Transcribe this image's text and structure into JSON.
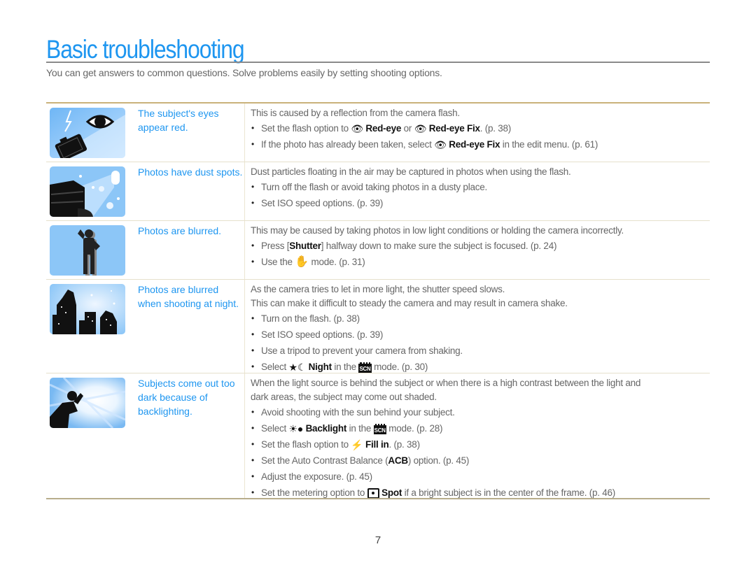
{
  "page": {
    "title": "Basic troubleshooting",
    "intro": "You can get answers to common questions. Solve problems easily by setting shooting options.",
    "page_number": "7",
    "accent_color": "#1e96f0",
    "rule_color": "#c9b27a"
  },
  "rows": [
    {
      "problem": "The subject's eyes appear red.",
      "image": "red-eye-illustration",
      "lead": [
        "This is caused by a reflection from the camera flash."
      ],
      "bullets": [
        {
          "pre": "Set the flash option to ",
          "icon1": "red-eye-icon",
          "bold1": "Red-eye",
          "mid": " or ",
          "icon2": "red-eye-fix-icon",
          "bold2": "Red-eye Fix",
          "post": ". (p. 38)"
        },
        {
          "pre": "If the photo has already been taken, select ",
          "icon1": "red-eye-fix-icon",
          "bold1": "Red-eye Fix",
          "post": " in the edit menu. (p. 61)"
        }
      ]
    },
    {
      "problem": "Photos have dust spots.",
      "image": "dust-spots-illustration",
      "lead": [
        "Dust particles floating in the air may be captured in photos when using the flash."
      ],
      "bullets": [
        {
          "text": "Turn off the flash or avoid taking photos in a dusty place."
        },
        {
          "text": "Set ISO speed options. (p. 39)"
        }
      ]
    },
    {
      "problem": "Photos are blurred.",
      "image": "blurred-person-illustration",
      "lead": [
        "This may be caused by taking photos in low light conditions or holding the camera incorrectly."
      ],
      "bullets": [
        {
          "pre": "Press [",
          "bold1": "Shutter",
          "post": "] halfway down to make sure the subject is focused. (p. 24)"
        },
        {
          "pre": "Use the ",
          "icon1": "dual-is-icon",
          "post": " mode. (p. 31)"
        }
      ]
    },
    {
      "problem": "Photos are blurred when shooting at night.",
      "image": "night-city-illustration",
      "lead": [
        "As the camera tries to let in more light, the shutter speed slows.",
        "This can make it difficult to steady the camera and may result in camera shake."
      ],
      "bullets": [
        {
          "text": "Turn on the flash. (p. 38)"
        },
        {
          "text": "Set ISO speed options. (p. 39)"
        },
        {
          "text": "Use a tripod to prevent your camera from shaking."
        },
        {
          "pre": "Select ",
          "icon1": "night-icon",
          "bold1": "Night",
          "mid": " in the ",
          "icon2": "scene-mode-icon",
          "post": " mode. (p. 30)"
        }
      ]
    },
    {
      "problem": "Subjects come out too dark because of backlighting.",
      "image": "backlight-illustration",
      "lead": [
        "When the light source is behind the subject or when there is a high contrast between the light and dark areas, the subject may come out shaded."
      ],
      "bullets": [
        {
          "text": "Avoid shooting with the sun behind your subject."
        },
        {
          "pre": "Select ",
          "icon1": "backlight-icon",
          "bold1": "Backlight",
          "mid": " in the ",
          "icon2": "scene-mode-icon",
          "post": " mode. (p. 28)"
        },
        {
          "pre": "Set the flash option to ",
          "icon1": "fill-in-flash-icon",
          "bold1": "Fill in",
          "post": ". (p. 38)"
        },
        {
          "pre": "Set the Auto Contrast Balance (",
          "bold1": "ACB",
          "post": ") option. (p. 45)"
        },
        {
          "text": "Adjust the exposure. (p. 45)"
        },
        {
          "pre": "Set the metering option to ",
          "icon1": "spot-metering-icon",
          "bold1": "Spot",
          "post": " if a bright subject is in the center of the frame. (p. 46)"
        }
      ]
    }
  ],
  "icons": {
    "scn_label": "SCN",
    "bullet": "•"
  }
}
